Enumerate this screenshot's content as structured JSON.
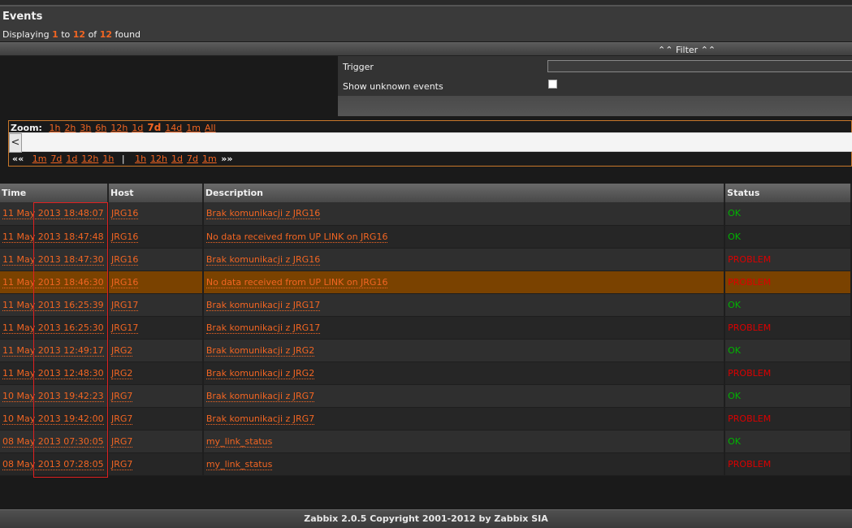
{
  "header": {
    "title": "Events",
    "displaying_prefix": "Displaying",
    "from": "1",
    "to_word": "to",
    "to": "12",
    "of_word": "of",
    "total": "12",
    "found_word": "found"
  },
  "filter": {
    "toggle_label": "Filter",
    "trigger_label": "Trigger",
    "trigger_value": "",
    "show_unknown_label": "Show unknown events",
    "show_unknown_checked": false
  },
  "zoom": {
    "label": "Zoom:",
    "options": [
      "1h",
      "2h",
      "3h",
      "6h",
      "12h",
      "1d",
      "7d",
      "14d",
      "1m",
      "All"
    ],
    "active": "7d",
    "scroll_left_glyph": "<",
    "back_arrow": "««",
    "back_links": [
      "1m",
      "7d",
      "1d",
      "12h",
      "1h"
    ],
    "separator": "|",
    "forward_links": [
      "1h",
      "12h",
      "1d",
      "7d",
      "1m"
    ],
    "forward_arrow": "»»"
  },
  "table": {
    "columns": [
      "Time",
      "Host",
      "Description",
      "Status"
    ],
    "rows": [
      {
        "time": "11 May 2013 18:48:07",
        "host": "JRG16",
        "description": "Brak komunikacji z JRG16",
        "status": "OK"
      },
      {
        "time": "11 May 2013 18:47:48",
        "host": "JRG16",
        "description": "No data received from UP LINK on JRG16",
        "status": "OK"
      },
      {
        "time": "11 May 2013 18:47:30",
        "host": "JRG16",
        "description": "Brak komunikacji z JRG16",
        "status": "PROBLEM"
      },
      {
        "time": "11 May 2013 18:46:30",
        "host": "JRG16",
        "description": "No data received from UP LINK on JRG16",
        "status": "PROBLEM"
      },
      {
        "time": "11 May 2013 16:25:39",
        "host": "JRG17",
        "description": "Brak komunikacji z JRG17",
        "status": "OK"
      },
      {
        "time": "11 May 2013 16:25:30",
        "host": "JRG17",
        "description": "Brak komunikacji z JRG17",
        "status": "PROBLEM"
      },
      {
        "time": "11 May 2013 12:49:17",
        "host": "JRG2",
        "description": "Brak komunikacji z JRG2",
        "status": "OK"
      },
      {
        "time": "11 May 2013 12:48:30",
        "host": "JRG2",
        "description": "Brak komunikacji z JRG2",
        "status": "PROBLEM"
      },
      {
        "time": "10 May 2013 19:42:23",
        "host": "JRG7",
        "description": "Brak komunikacji z JRG7",
        "status": "OK"
      },
      {
        "time": "10 May 2013 19:42:00",
        "host": "JRG7",
        "description": "Brak komunikacji z JRG7",
        "status": "PROBLEM"
      },
      {
        "time": "08 May 2013 07:30:05",
        "host": "JRG7",
        "description": "my_link_status",
        "status": "OK"
      },
      {
        "time": "08 May 2013 07:28:05",
        "host": "JRG7",
        "description": "my_link_status",
        "status": "PROBLEM"
      }
    ],
    "highlighted_row": 3
  },
  "colors": {
    "accent": "#f26522",
    "ok": "#00b400",
    "problem": "#dc0000",
    "highlight_row": "#7a4200"
  },
  "footer": {
    "text": "Zabbix 2.0.5 Copyright 2001-2012 by Zabbix SIA"
  }
}
